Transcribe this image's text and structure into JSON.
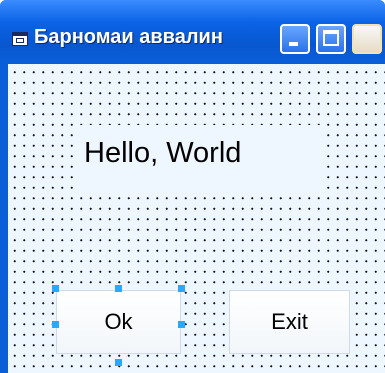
{
  "window": {
    "title": "Барномаи аввалин",
    "controls": [
      "minimize-icon",
      "maximize-icon",
      "close-icon"
    ]
  },
  "form": {
    "label_text": "Hello, World",
    "ok_button_label": "Ok",
    "exit_button_label": "Exit",
    "selected_control": "ok-button"
  },
  "colors": {
    "title_bar": "#0a5fd8",
    "form_background": "#eef7ff",
    "grid_dots": "#111111",
    "selection_handles": "#2aa7ff"
  }
}
